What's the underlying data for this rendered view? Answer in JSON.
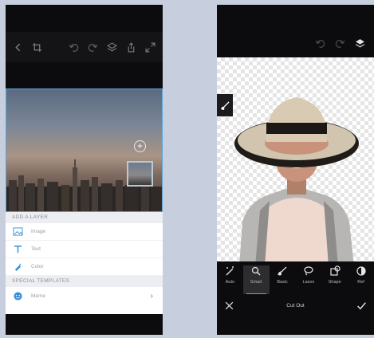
{
  "left_screen": {
    "panel": {
      "add_layer_header": "ADD A LAYER",
      "layer_options": [
        {
          "label": "Image",
          "icon": "image-icon"
        },
        {
          "label": "Text",
          "icon": "text-icon"
        },
        {
          "label": "Color",
          "icon": "color-icon"
        }
      ],
      "special_templates_header": "SPECIAL TEMPLATES",
      "template_item": {
        "label": "Meme",
        "icon": "smiley-icon"
      }
    },
    "colors": {
      "selection": "#5ba4d8",
      "accent": "#3b8fd6"
    }
  },
  "right_screen": {
    "tools": [
      {
        "label": "Auto",
        "icon": "magic-wand-icon",
        "active": false
      },
      {
        "label": "Smart",
        "icon": "smart-select-icon",
        "active": true
      },
      {
        "label": "Basic",
        "icon": "brush-icon",
        "active": false
      },
      {
        "label": "Lasso",
        "icon": "lasso-icon",
        "active": false
      },
      {
        "label": "Shape",
        "icon": "shape-icon",
        "active": false
      },
      {
        "label": "Ref",
        "icon": "refine-icon",
        "active": false
      }
    ],
    "bottom_title": "Cut Out",
    "colors": {
      "active_underline": "#5aa7e4"
    }
  }
}
